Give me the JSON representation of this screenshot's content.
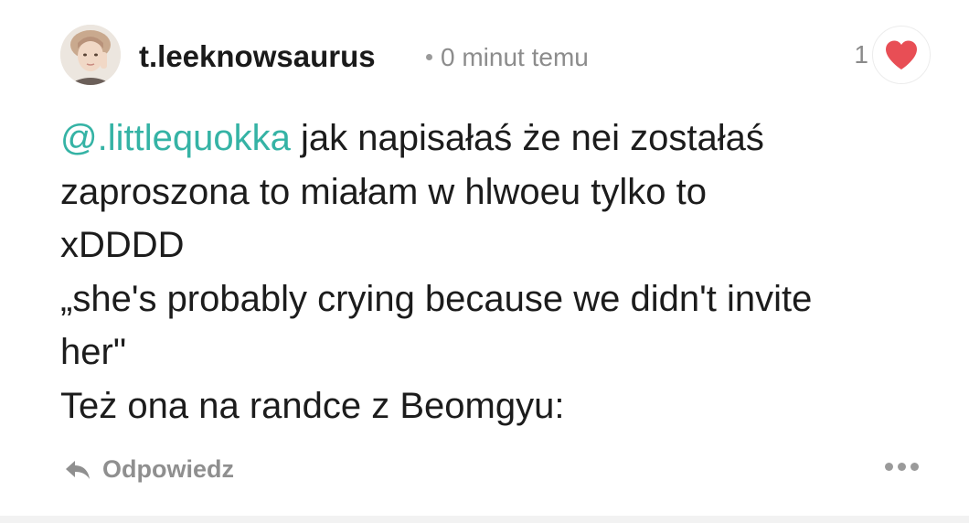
{
  "comment": {
    "username": "t.leeknowsaurus",
    "timestamp": "0 minut temu",
    "likes": {
      "count": "1",
      "icon": "heart-icon",
      "color": "#e84e55"
    },
    "body": {
      "mention": "@.littlequokka",
      "line1_rest": " jak napisałaś że nei zostałaś",
      "line2": "zaproszona to miałam w hlwoeu tylko to",
      "line3": "xDDDD",
      "line4": "„she's probably crying because we didn't invite",
      "line5": "her\"",
      "line6": "Też ona na randce z Beomgyu:"
    },
    "actions": {
      "reply_label": "Odpowiedz",
      "reply_icon": "reply-arrow-icon",
      "more_icon": "more-dots-icon"
    }
  },
  "colors": {
    "mention": "#35b3a5",
    "text": "#1c1c1c",
    "muted": "#8c8c8c"
  }
}
